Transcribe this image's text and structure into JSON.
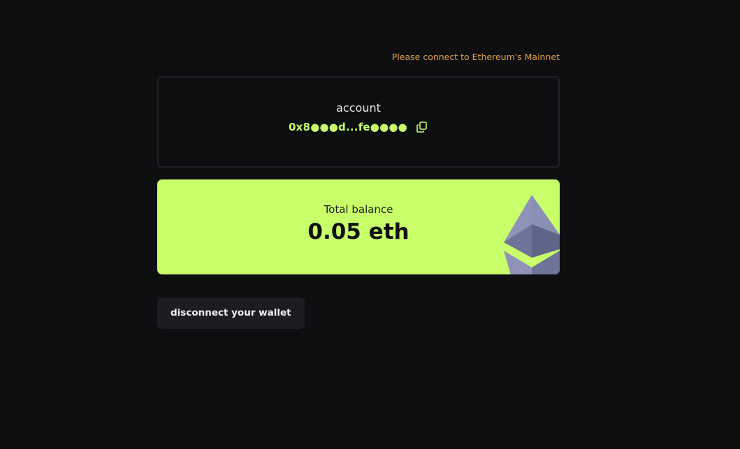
{
  "network": {
    "warning": "Please connect to Ethereum's Mainnet",
    "warning_color": "#e0a24a"
  },
  "account": {
    "label": "account",
    "address": "0x8●●●d...fe●●●●",
    "copy_icon": "copy-icon"
  },
  "balance": {
    "label": "Total balance",
    "value": "0.05 eth",
    "logo_icon": "ethereum-icon",
    "background_color": "#c8ff6a"
  },
  "actions": {
    "disconnect_label": "disconnect your wallet"
  }
}
